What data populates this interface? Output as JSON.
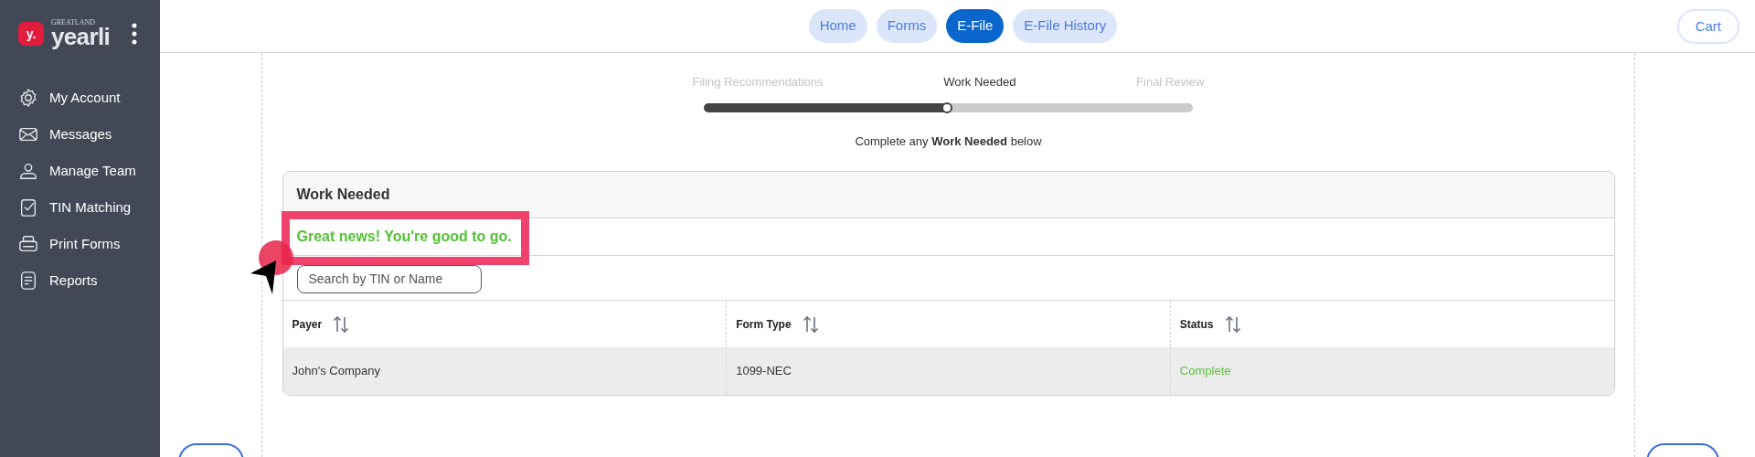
{
  "logo": {
    "mark": "y.",
    "overline": "GREATLAND",
    "wordmark": "yearli"
  },
  "sidebar": {
    "items": [
      {
        "label": "My Account",
        "kind": "gear"
      },
      {
        "label": "Messages",
        "kind": "mail"
      },
      {
        "label": "Manage Team",
        "kind": "user"
      },
      {
        "label": "TIN Matching",
        "kind": "check"
      },
      {
        "label": "Print Forms",
        "kind": "printer"
      },
      {
        "label": "Reports",
        "kind": "report"
      }
    ]
  },
  "nav": {
    "tabs": [
      {
        "label": "Home",
        "selected": false
      },
      {
        "label": "Forms",
        "selected": false
      },
      {
        "label": "E-File",
        "selected": true
      },
      {
        "label": "E-File History",
        "selected": false
      }
    ],
    "cart": "Cart"
  },
  "steps": {
    "items": [
      {
        "label": "Filing Recommendations",
        "selected": false
      },
      {
        "label": "Work Needed",
        "selected": true
      },
      {
        "label": "Final Review",
        "selected": false
      }
    ],
    "level": 0.5
  },
  "instruction": "Complete any **Work Needed** below",
  "card": {
    "title": "Work Needed",
    "message": "Great news! You're good to go.",
    "search": {
      "placeholder": "Search by TIN or Name"
    },
    "table": {
      "columns": [
        "Payer",
        "Form Type",
        "Status"
      ],
      "rows": [
        {
          "cells": [
            "John's Company",
            "1099-NEC",
            "Complete"
          ],
          "color": "#5ac43a"
        }
      ]
    }
  }
}
